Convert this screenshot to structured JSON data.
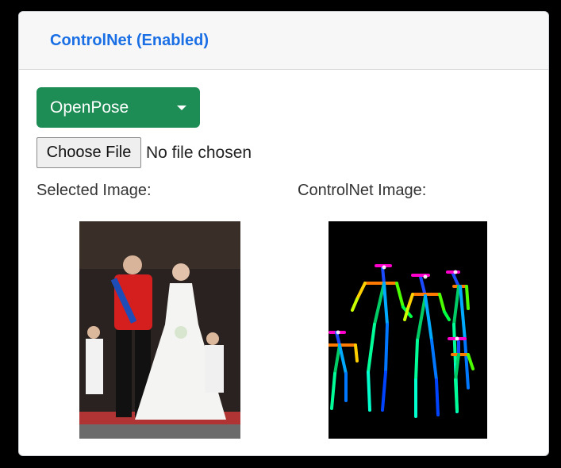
{
  "panel": {
    "title": "ControlNet (Enabled)"
  },
  "preprocessor": {
    "selected": "OpenPose"
  },
  "file_input": {
    "button_label": "Choose File",
    "status": "No file chosen"
  },
  "selected_image": {
    "label": "Selected Image:"
  },
  "controlnet_image": {
    "label": "ControlNet Image:"
  },
  "colors": {
    "title": "#1a6fe5",
    "dropdown": "#1d8d55",
    "header_bg": "#f7f7f7",
    "page_bg": "#000000"
  }
}
